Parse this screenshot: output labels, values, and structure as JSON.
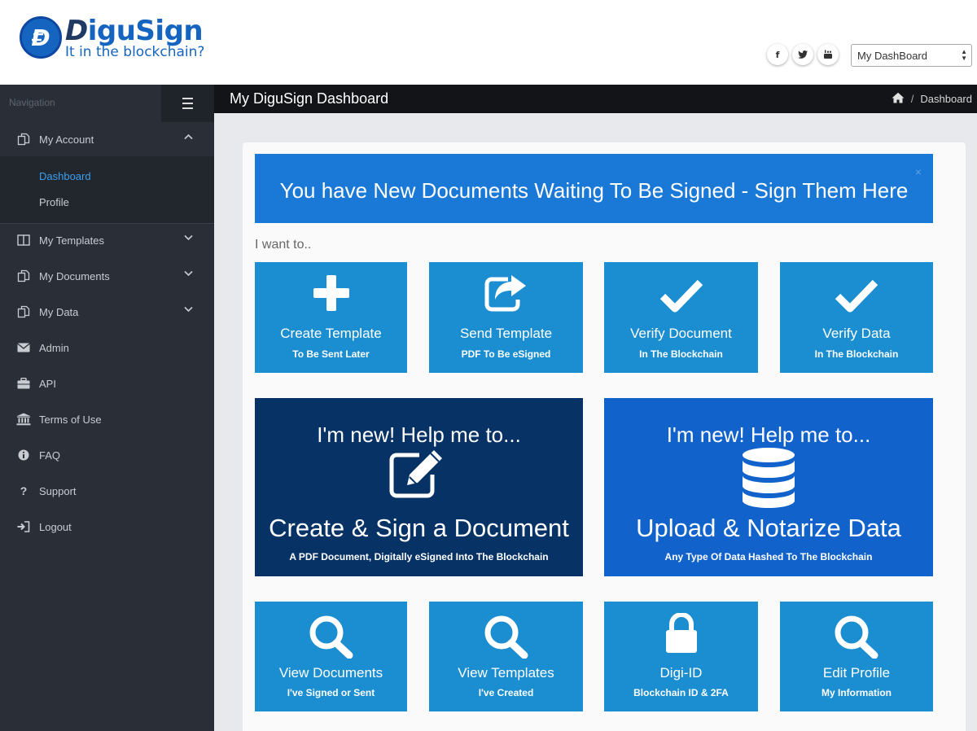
{
  "brand": {
    "name_d": "D",
    "name_rest": "iguSign",
    "tagline": "It in the blockchain?"
  },
  "social": {
    "facebook": "f",
    "twitter": "t",
    "youtube": "yt"
  },
  "header": {
    "dashboard_select": "My DashBoard"
  },
  "sidebar": {
    "nav_label": "Navigation",
    "items": [
      {
        "label": "My Account",
        "icon": "documents-icon"
      },
      {
        "label": "My Templates",
        "icon": "columns-icon"
      },
      {
        "label": "My Documents",
        "icon": "documents-icon"
      },
      {
        "label": "My Data",
        "icon": "documents-icon"
      },
      {
        "label": "Admin",
        "icon": "envelope-icon"
      },
      {
        "label": "API",
        "icon": "briefcase-icon"
      },
      {
        "label": "Terms of Use",
        "icon": "bank-icon"
      },
      {
        "label": "FAQ",
        "icon": "info-icon"
      },
      {
        "label": "Support",
        "icon": "question-icon"
      },
      {
        "label": "Logout",
        "icon": "sign-out-icon"
      }
    ],
    "sub_items": [
      "Dashboard",
      "Profile"
    ]
  },
  "main": {
    "title": "My DiguSign Dashboard",
    "breadcrumb_sep": "/",
    "breadcrumb_current": "Dashboard",
    "banner": "You have New Documents Waiting To Be Signed - Sign Them Here",
    "banner_close": "×",
    "i_want": "I want to..",
    "tiles_top": [
      {
        "title": "Create Template",
        "sub": "To Be Sent Later",
        "icon": "plus-icon"
      },
      {
        "title": "Send Template",
        "sub": "PDF To Be eSigned",
        "icon": "share-icon"
      },
      {
        "title": "Verify Document",
        "sub": "In The Blockchain",
        "icon": "check-icon"
      },
      {
        "title": "Verify Data",
        "sub": "In The Blockchain",
        "icon": "check-icon"
      }
    ],
    "big_tiles": [
      {
        "heading": "I'm new! Help me to...",
        "title": "Create & Sign a Document",
        "sub": "A PDF Document, Digitally eSigned Into The Blockchain",
        "icon": "edit-icon",
        "color": "#063266"
      },
      {
        "heading": "I'm new! Help me to...",
        "title": "Upload & Notarize Data",
        "sub": "Any Type Of Data Hashed To The Blockchain",
        "icon": "database-icon",
        "color": "#1262cc"
      }
    ],
    "tiles_bottom": [
      {
        "title": "View Documents",
        "sub": "I've Signed or Sent",
        "icon": "search-icon"
      },
      {
        "title": "View Templates",
        "sub": "I've Created",
        "icon": "search-icon"
      },
      {
        "title": "Digi-ID",
        "sub": "Blockchain ID & 2FA",
        "icon": "lock-icon"
      },
      {
        "title": "Edit Profile",
        "sub": "My Information",
        "icon": "search-icon"
      }
    ],
    "tile_color": "#1b8ed1"
  }
}
